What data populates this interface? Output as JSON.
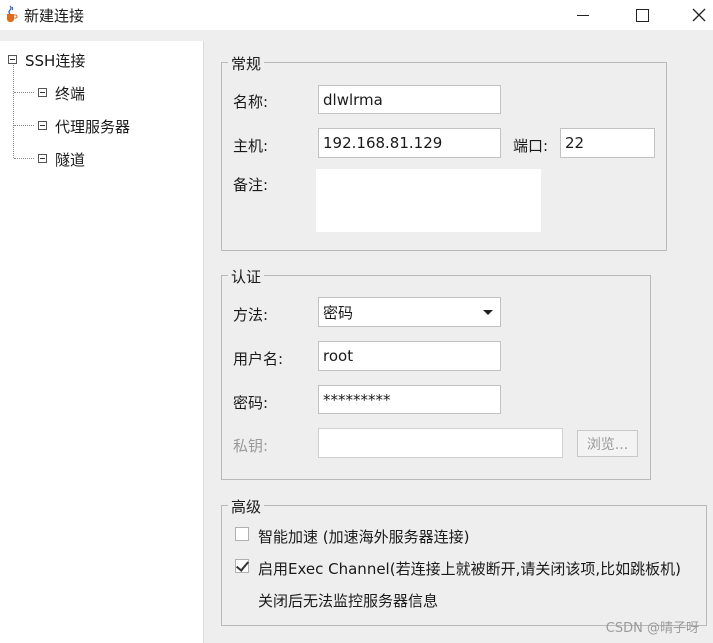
{
  "window": {
    "title": "新建连接"
  },
  "tree": {
    "root_label": "SSH连接",
    "children": [
      {
        "label": "终端"
      },
      {
        "label": "代理服务器"
      },
      {
        "label": "隧道"
      }
    ]
  },
  "general": {
    "legend": "常规",
    "name_label": "名称:",
    "name_value": "dlwlrma",
    "host_label": "主机:",
    "host_value": "192.168.81.129",
    "port_label": "端口:",
    "port_value": "22",
    "note_label": "备注:",
    "note_value": ""
  },
  "auth": {
    "legend": "认证",
    "method_label": "方法:",
    "method_value": "密码",
    "user_label": "用户名:",
    "user_value": "root",
    "password_label": "密码:",
    "password_value": "*********",
    "key_label": "私钥:",
    "key_value": "",
    "browse_label": "浏览..."
  },
  "advanced": {
    "legend": "高级",
    "accel_label": "智能加速 (加速海外服务器连接)",
    "accel_checked": false,
    "exec_label": "启用Exec Channel(若连接上就被断开,请关闭该项,比如跳板机)",
    "exec_checked": true,
    "exec_note": "关闭后无法监控服务器信息"
  },
  "watermark": "CSDN @晴子呀",
  "icons": {
    "app": "java-cup-icon",
    "minimize": "minimize-icon",
    "maximize": "maximize-icon",
    "close": "close-icon"
  }
}
